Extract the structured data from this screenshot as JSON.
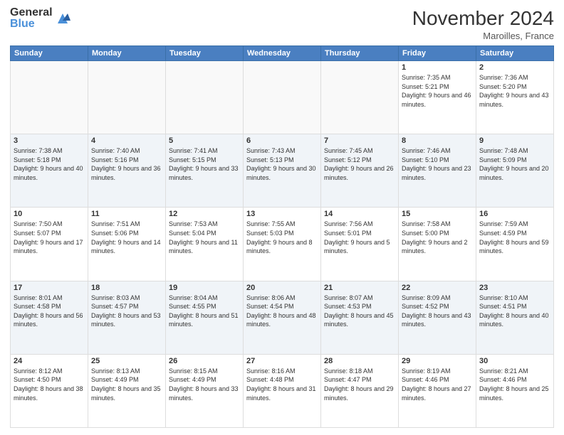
{
  "logo": {
    "general": "General",
    "blue": "Blue"
  },
  "title": "November 2024",
  "location": "Maroilles, France",
  "days_header": [
    "Sunday",
    "Monday",
    "Tuesday",
    "Wednesday",
    "Thursday",
    "Friday",
    "Saturday"
  ],
  "weeks": [
    [
      {
        "day": "",
        "info": ""
      },
      {
        "day": "",
        "info": ""
      },
      {
        "day": "",
        "info": ""
      },
      {
        "day": "",
        "info": ""
      },
      {
        "day": "",
        "info": ""
      },
      {
        "day": "1",
        "info": "Sunrise: 7:35 AM\nSunset: 5:21 PM\nDaylight: 9 hours and 46 minutes."
      },
      {
        "day": "2",
        "info": "Sunrise: 7:36 AM\nSunset: 5:20 PM\nDaylight: 9 hours and 43 minutes."
      }
    ],
    [
      {
        "day": "3",
        "info": "Sunrise: 7:38 AM\nSunset: 5:18 PM\nDaylight: 9 hours and 40 minutes."
      },
      {
        "day": "4",
        "info": "Sunrise: 7:40 AM\nSunset: 5:16 PM\nDaylight: 9 hours and 36 minutes."
      },
      {
        "day": "5",
        "info": "Sunrise: 7:41 AM\nSunset: 5:15 PM\nDaylight: 9 hours and 33 minutes."
      },
      {
        "day": "6",
        "info": "Sunrise: 7:43 AM\nSunset: 5:13 PM\nDaylight: 9 hours and 30 minutes."
      },
      {
        "day": "7",
        "info": "Sunrise: 7:45 AM\nSunset: 5:12 PM\nDaylight: 9 hours and 26 minutes."
      },
      {
        "day": "8",
        "info": "Sunrise: 7:46 AM\nSunset: 5:10 PM\nDaylight: 9 hours and 23 minutes."
      },
      {
        "day": "9",
        "info": "Sunrise: 7:48 AM\nSunset: 5:09 PM\nDaylight: 9 hours and 20 minutes."
      }
    ],
    [
      {
        "day": "10",
        "info": "Sunrise: 7:50 AM\nSunset: 5:07 PM\nDaylight: 9 hours and 17 minutes."
      },
      {
        "day": "11",
        "info": "Sunrise: 7:51 AM\nSunset: 5:06 PM\nDaylight: 9 hours and 14 minutes."
      },
      {
        "day": "12",
        "info": "Sunrise: 7:53 AM\nSunset: 5:04 PM\nDaylight: 9 hours and 11 minutes."
      },
      {
        "day": "13",
        "info": "Sunrise: 7:55 AM\nSunset: 5:03 PM\nDaylight: 9 hours and 8 minutes."
      },
      {
        "day": "14",
        "info": "Sunrise: 7:56 AM\nSunset: 5:01 PM\nDaylight: 9 hours and 5 minutes."
      },
      {
        "day": "15",
        "info": "Sunrise: 7:58 AM\nSunset: 5:00 PM\nDaylight: 9 hours and 2 minutes."
      },
      {
        "day": "16",
        "info": "Sunrise: 7:59 AM\nSunset: 4:59 PM\nDaylight: 8 hours and 59 minutes."
      }
    ],
    [
      {
        "day": "17",
        "info": "Sunrise: 8:01 AM\nSunset: 4:58 PM\nDaylight: 8 hours and 56 minutes."
      },
      {
        "day": "18",
        "info": "Sunrise: 8:03 AM\nSunset: 4:57 PM\nDaylight: 8 hours and 53 minutes."
      },
      {
        "day": "19",
        "info": "Sunrise: 8:04 AM\nSunset: 4:55 PM\nDaylight: 8 hours and 51 minutes."
      },
      {
        "day": "20",
        "info": "Sunrise: 8:06 AM\nSunset: 4:54 PM\nDaylight: 8 hours and 48 minutes."
      },
      {
        "day": "21",
        "info": "Sunrise: 8:07 AM\nSunset: 4:53 PM\nDaylight: 8 hours and 45 minutes."
      },
      {
        "day": "22",
        "info": "Sunrise: 8:09 AM\nSunset: 4:52 PM\nDaylight: 8 hours and 43 minutes."
      },
      {
        "day": "23",
        "info": "Sunrise: 8:10 AM\nSunset: 4:51 PM\nDaylight: 8 hours and 40 minutes."
      }
    ],
    [
      {
        "day": "24",
        "info": "Sunrise: 8:12 AM\nSunset: 4:50 PM\nDaylight: 8 hours and 38 minutes."
      },
      {
        "day": "25",
        "info": "Sunrise: 8:13 AM\nSunset: 4:49 PM\nDaylight: 8 hours and 35 minutes."
      },
      {
        "day": "26",
        "info": "Sunrise: 8:15 AM\nSunset: 4:49 PM\nDaylight: 8 hours and 33 minutes."
      },
      {
        "day": "27",
        "info": "Sunrise: 8:16 AM\nSunset: 4:48 PM\nDaylight: 8 hours and 31 minutes."
      },
      {
        "day": "28",
        "info": "Sunrise: 8:18 AM\nSunset: 4:47 PM\nDaylight: 8 hours and 29 minutes."
      },
      {
        "day": "29",
        "info": "Sunrise: 8:19 AM\nSunset: 4:46 PM\nDaylight: 8 hours and 27 minutes."
      },
      {
        "day": "30",
        "info": "Sunrise: 8:21 AM\nSunset: 4:46 PM\nDaylight: 8 hours and 25 minutes."
      }
    ]
  ]
}
